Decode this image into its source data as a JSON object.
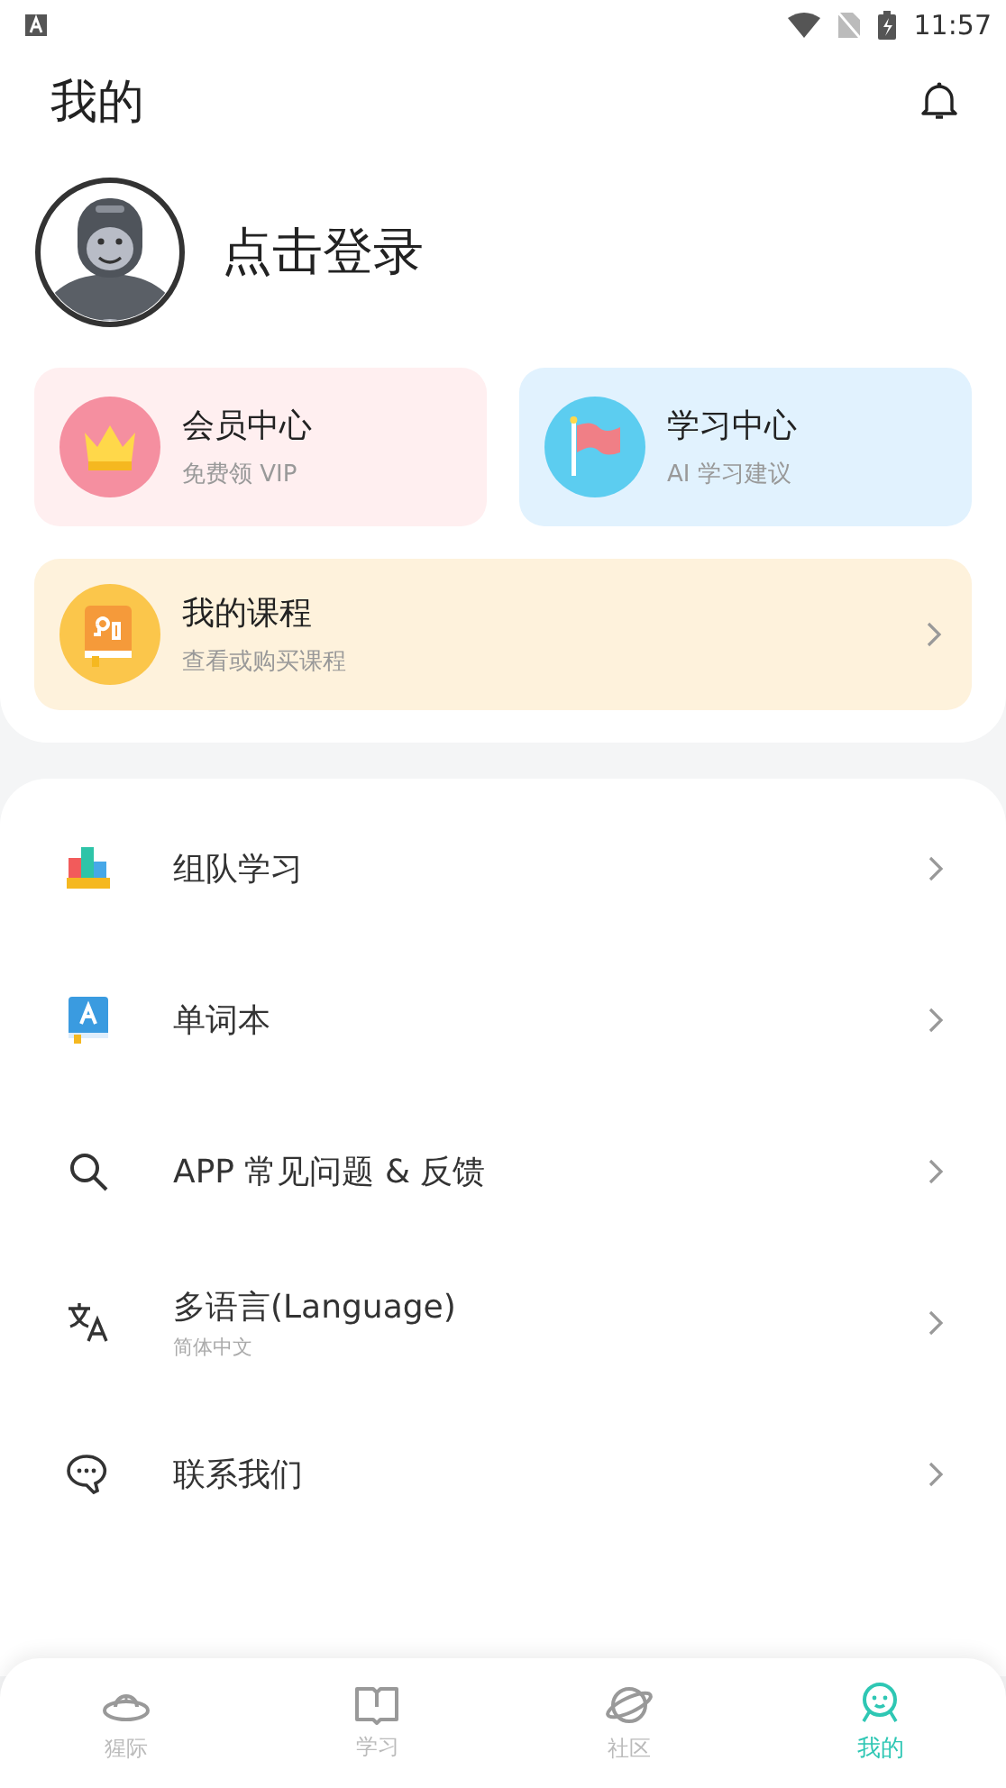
{
  "status_bar": {
    "time": "11:57"
  },
  "header": {
    "title": "我的"
  },
  "profile": {
    "login_label": "点击登录"
  },
  "feature_cards": [
    {
      "kind": "vip",
      "title": "会员中心",
      "subtitle": "免费领 VIP",
      "arrow": false
    },
    {
      "kind": "study",
      "title": "学习中心",
      "subtitle": "AI 学习建议",
      "arrow": false
    },
    {
      "kind": "course",
      "title": "我的课程",
      "subtitle": "查看或购买课程",
      "arrow": true
    }
  ],
  "menu": [
    {
      "kind": "team",
      "label": "组队学习"
    },
    {
      "kind": "wordbook",
      "label": "单词本"
    },
    {
      "kind": "search",
      "label": "APP 常见问题 & 反馈"
    },
    {
      "kind": "language",
      "label": "多语言(Language)",
      "detail": "简体中文"
    },
    {
      "kind": "chat",
      "label": "联系我们"
    }
  ],
  "tabs": [
    {
      "kind": "ufo",
      "label": "猩际",
      "selected": false
    },
    {
      "kind": "book",
      "label": "学习",
      "selected": false
    },
    {
      "kind": "planet",
      "label": "社区",
      "selected": false
    },
    {
      "kind": "face",
      "label": "我的",
      "selected": true
    }
  ]
}
